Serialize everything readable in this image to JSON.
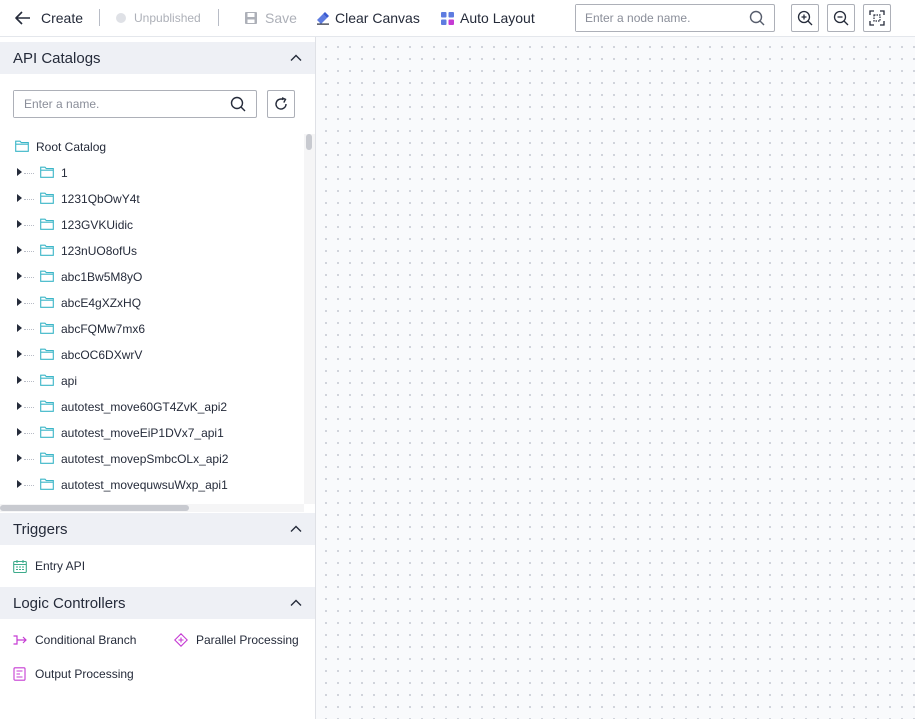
{
  "toolbar": {
    "create_label": "Create",
    "status_label": "Unpublished",
    "save_label": "Save",
    "clear_label": "Clear Canvas",
    "auto_layout_label": "Auto Layout",
    "node_search_placeholder": "Enter a node name.",
    "zoom_in_icon": "zoom-in-icon",
    "zoom_out_icon": "zoom-out-icon",
    "fit_icon": "fit-screen-icon"
  },
  "api_catalogs": {
    "title": "API Catalogs",
    "search_placeholder": "Enter a name.",
    "root_label": "Root Catalog",
    "items": [
      "1",
      "1231QbOwY4t",
      "123GVKUidic",
      "123nUO8ofUs",
      "abc1Bw5M8yO",
      "abcE4gXZxHQ",
      "abcFQMw7mx6",
      "abcOC6DXwrV",
      "api",
      "autotest_move60GT4ZvK_api2",
      "autotest_moveEiP1DVx7_api1",
      "autotest_movepSmbcOLx_api2",
      "autotest_movequwsuWxp_api1"
    ]
  },
  "triggers": {
    "title": "Triggers",
    "entry_api_label": "Entry API"
  },
  "logic_controllers": {
    "title": "Logic Controllers",
    "conditional_branch_label": "Conditional Branch",
    "parallel_processing_label": "Parallel Processing",
    "output_processing_label": "Output Processing"
  },
  "colors": {
    "accent": "#5e7ce0",
    "folder": "#3bb6c8",
    "trigger": "#3dab8b",
    "controller": "#c53bd3",
    "section_bg": "#eef0f5",
    "canvas_bg": "#f9fafc"
  }
}
